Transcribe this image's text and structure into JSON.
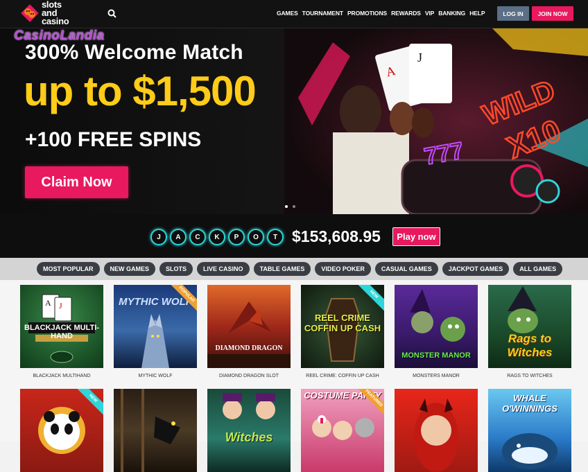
{
  "header": {
    "logo_line1": "slots",
    "logo_line2": "and",
    "logo_line3": "casino",
    "nav": [
      "GAMES",
      "TOURNAMENT",
      "PROMOTIONS",
      "REWARDS",
      "VIP",
      "BANKING",
      "HELP"
    ],
    "login_label": "LOG IN",
    "join_label": "JOIN NOW"
  },
  "hero": {
    "sub_logo": "CasinoLandia",
    "line1": "300% Welcome Match",
    "line2": "up to $1,500",
    "line3": "+100 FREE SPINS",
    "cta": "Claim Now",
    "neon_text": "WILD X10",
    "slides": 2,
    "active_slide": 1
  },
  "jackpot": {
    "letters": [
      "J",
      "A",
      "C",
      "K",
      "P",
      "O",
      "T"
    ],
    "amount": "$153,608.95",
    "cta": "Play now"
  },
  "categories": [
    "MOST POPULAR",
    "NEW GAMES",
    "SLOTS",
    "LIVE CASINO",
    "TABLE GAMES",
    "VIDEO POKER",
    "CASUAL GAMES",
    "JACKPOT GAMES",
    "ALL GAMES"
  ],
  "games_row1": [
    {
      "title": "BLACKJACK MULTI-HAND",
      "label": "BLACKJACK MULTIHAND",
      "ribbon": ""
    },
    {
      "title": "MYTHIC WOLF",
      "label": "MYTHIC WOLF",
      "ribbon": "POPULAR"
    },
    {
      "title": "DIAMOND DRAGON",
      "label": "DIAMOND DRAGON SLOT",
      "ribbon": ""
    },
    {
      "title": "REEL CRIME COFFIN UP CASH",
      "label": "REEL CRIME: COFFIN UP CASH",
      "ribbon": "NEW"
    },
    {
      "title": "MONSTER MANOR",
      "label": "MONSTERS MANOR",
      "ribbon": ""
    },
    {
      "title": "Rags to Witches",
      "label": "RAGS TO WITCHES",
      "ribbon": ""
    }
  ],
  "games_row2": [
    {
      "title": "",
      "ribbon": "NEW"
    },
    {
      "title": "",
      "ribbon": ""
    },
    {
      "title": "Witches",
      "ribbon": ""
    },
    {
      "title": "COSTUME PARTY",
      "ribbon": "FEATURED"
    },
    {
      "title": "",
      "ribbon": ""
    },
    {
      "title": "WHALE O'WINNINGS",
      "ribbon": ""
    }
  ],
  "colors": {
    "brand": "#e8195e",
    "login": "#5b6f86",
    "accent_yellow": "#ffcc18",
    "jackpot_ring": "#2fd5d8"
  }
}
